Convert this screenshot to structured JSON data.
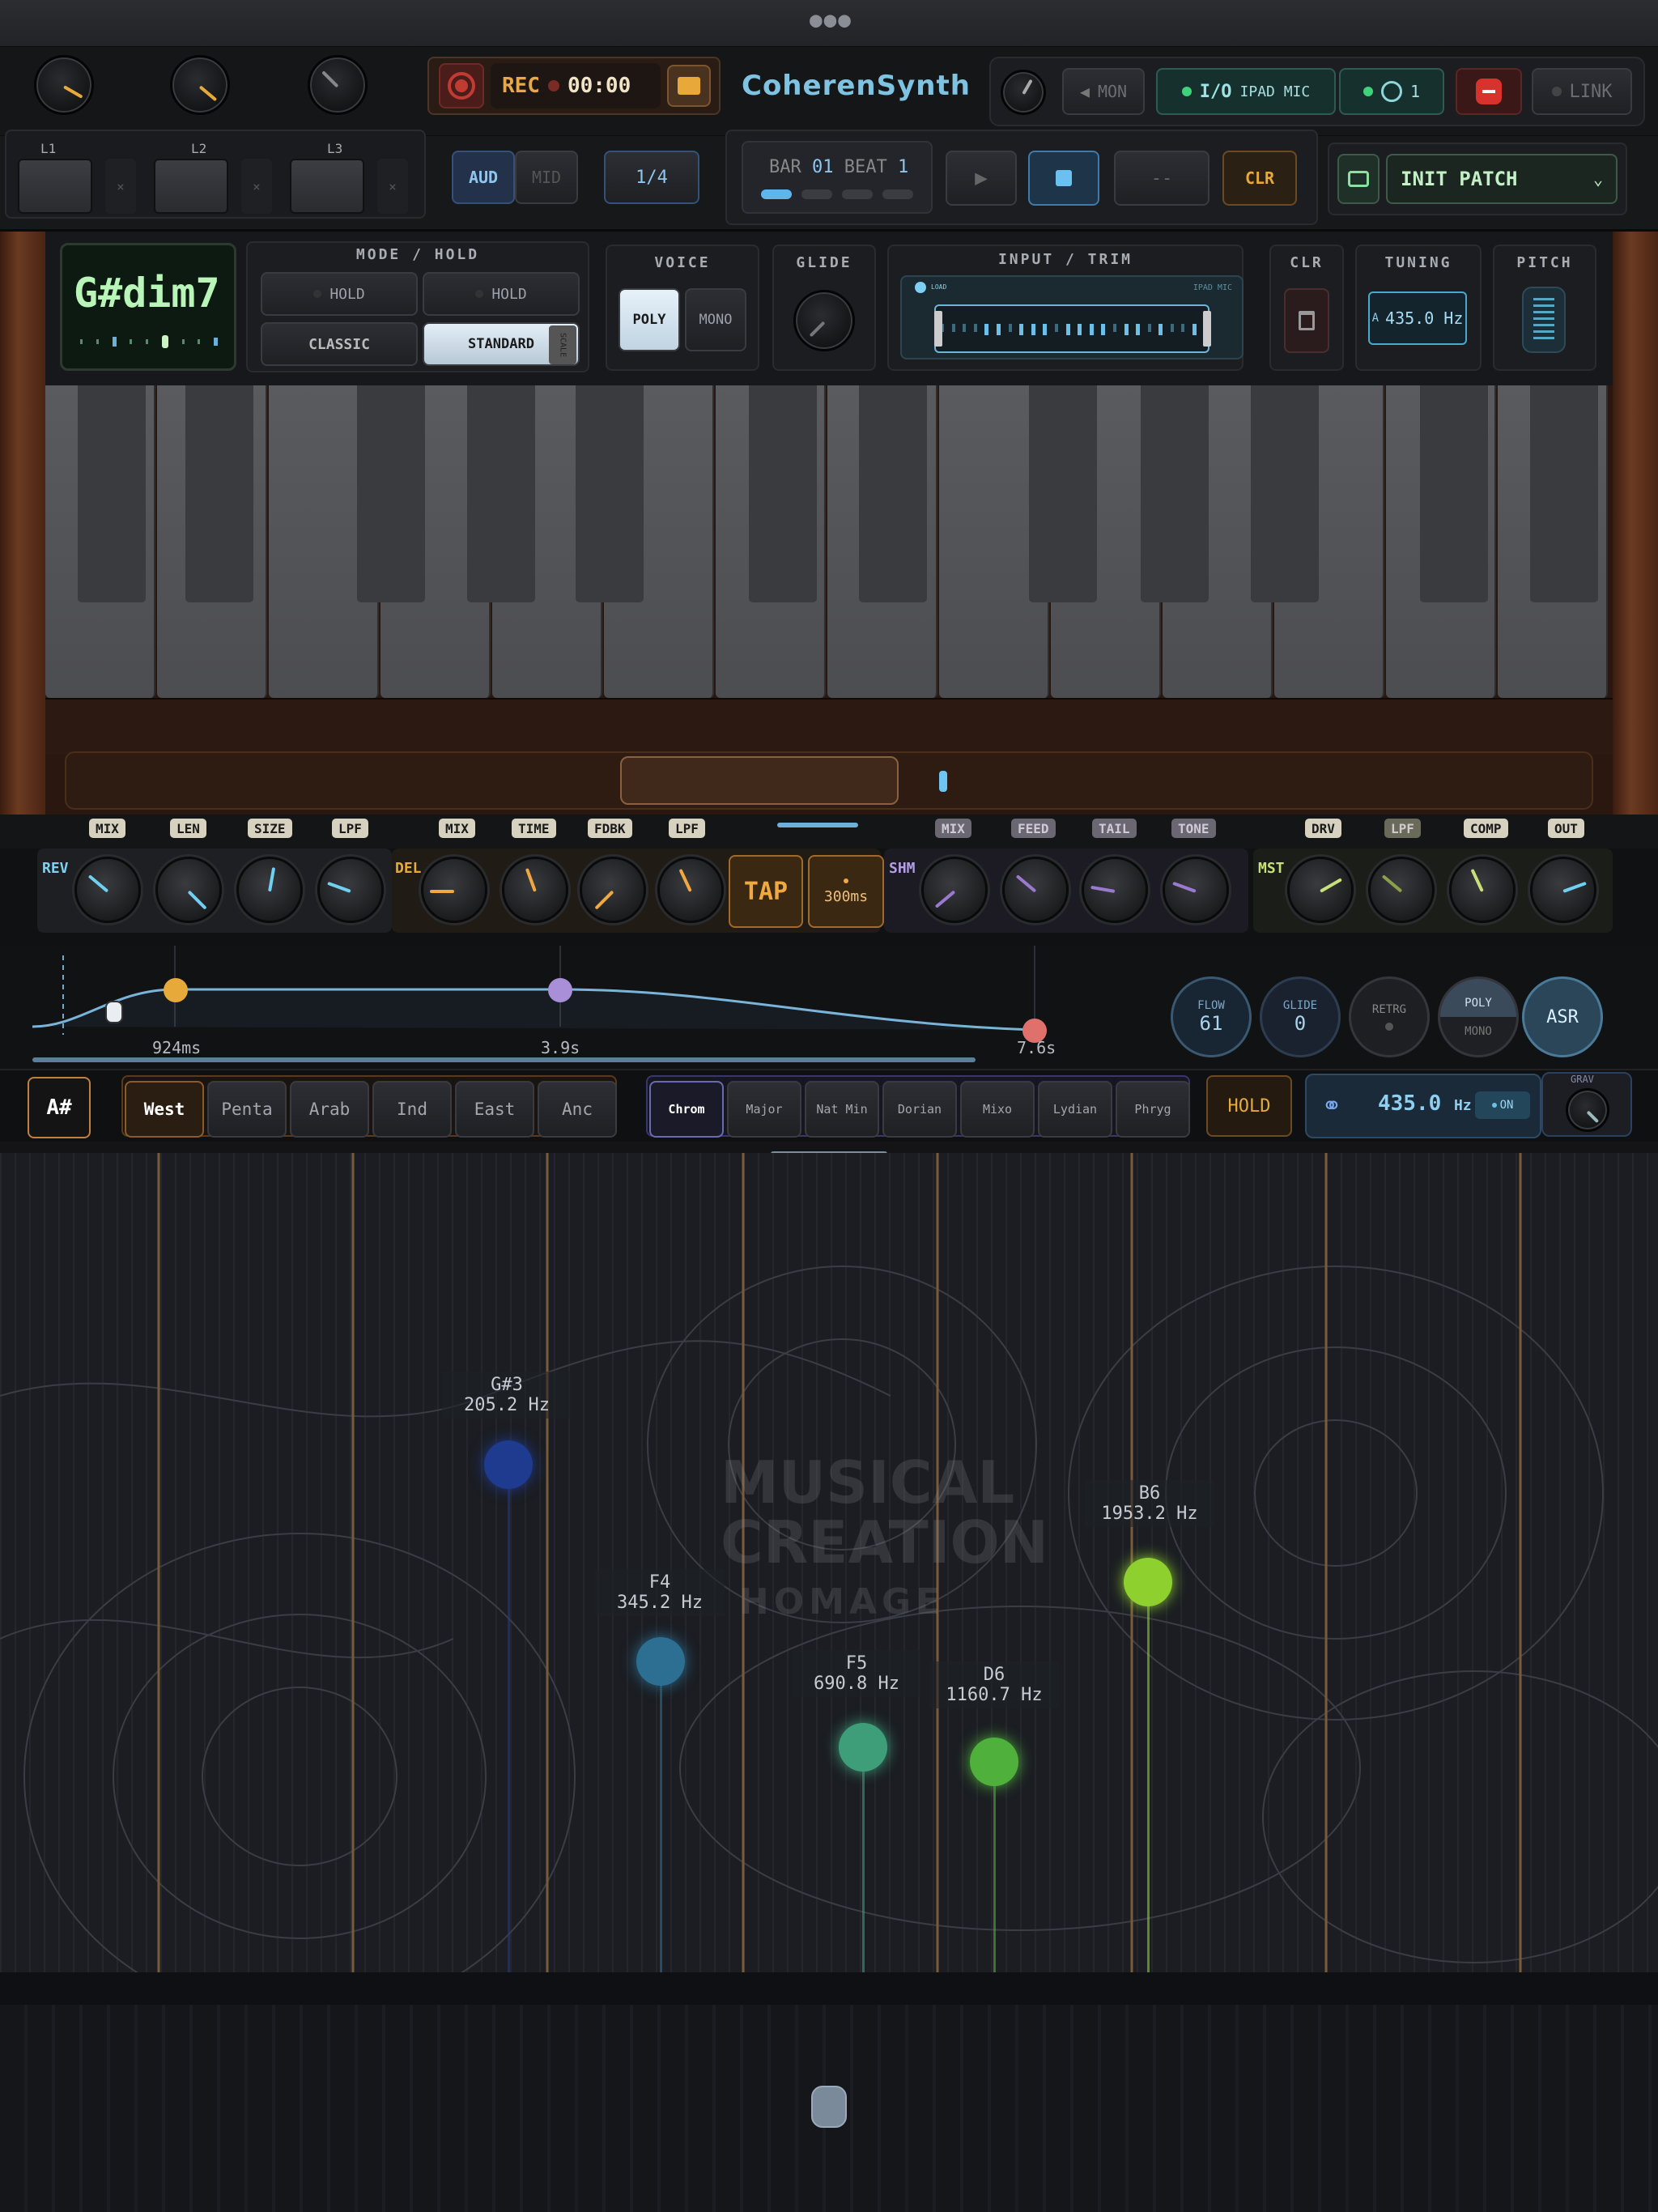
{
  "header": {
    "more_icon": "ellipsis-icon",
    "rec_label": "REC",
    "rec_time": "00:00",
    "app_title": "CoherenSynth",
    "mon_label": "MON",
    "io_label": "I/O",
    "io_source": "IPAD MIC",
    "midi_count": "1",
    "link_label": "LINK"
  },
  "loops": [
    {
      "label": "L1"
    },
    {
      "label": "L2"
    },
    {
      "label": "L3"
    }
  ],
  "transport": {
    "aud_label": "AUD",
    "mid_label": "MID",
    "quant": "1/4",
    "bar_label": "BAR",
    "bar_value": "01",
    "beat_label": "BEAT",
    "beat_value": "1",
    "dash": "--",
    "clr": "CLR"
  },
  "patch": {
    "name": "INIT PATCH"
  },
  "chord": {
    "name": "G#dim7"
  },
  "mode_hold": {
    "title": "MODE / HOLD",
    "hold1": "HOLD",
    "hold2": "HOLD",
    "classic": "CLASSIC",
    "standard": "STANDARD",
    "scale_tab": "SCALE"
  },
  "voice": {
    "title": "VOICE",
    "poly": "POLY",
    "mono": "MONO"
  },
  "glide": {
    "title": "GLIDE"
  },
  "input_trim": {
    "title": "INPUT / TRIM",
    "load": "LOAD",
    "source": "IPAD MIC"
  },
  "clr_panel": {
    "title": "CLR"
  },
  "tuning": {
    "title": "TUNING",
    "note": "A",
    "value": "435.0 Hz"
  },
  "pitch": {
    "title": "PITCH"
  },
  "fx_tags": [
    "MIX",
    "LEN",
    "SIZE",
    "LPF",
    "MIX",
    "TIME",
    "FDBK",
    "LPF",
    "MIX",
    "FEED",
    "TAIL",
    "TONE",
    "DRV",
    "LPF",
    "COMP",
    "OUT"
  ],
  "fx_sections": {
    "rev": "REV",
    "del": "DEL",
    "shm": "SHM",
    "mst": "MST",
    "tap": "TAP",
    "delay_time": "300ms"
  },
  "envelope": {
    "t1": "924ms",
    "t2": "3.9s",
    "t3": "7.6s",
    "flow_label": "FLOW",
    "flow_value": "61",
    "glide_label": "GLIDE",
    "glide_value": "0",
    "retrg": "RETRG",
    "poly": "POLY",
    "mono": "MONO",
    "asr": "ASR"
  },
  "scales": {
    "root": "A#",
    "cultures": [
      "West",
      "Penta",
      "Arab",
      "Ind",
      "East",
      "Anc"
    ],
    "modes": [
      "Chrom",
      "Major",
      "Nat Min",
      "Dorian",
      "Mixo",
      "Lydian",
      "Phryg"
    ],
    "hold": "HOLD",
    "freq": "435.0",
    "freq_unit": "Hz",
    "on": "ON",
    "grav": "GRAV"
  },
  "watermark": {
    "line1": "MUSICAL",
    "line2": "CREATION",
    "line3": "HOMAGE"
  },
  "nodes": [
    {
      "note": "G#3",
      "freq": "205.2 Hz",
      "color": "#1f3b8f"
    },
    {
      "note": "F4",
      "freq": "345.2 Hz",
      "color": "#2c6f93"
    },
    {
      "note": "F5",
      "freq": "690.8 Hz",
      "color": "#3f9e7a"
    },
    {
      "note": "D6",
      "freq": "1160.7 Hz",
      "color": "#4fb03c"
    },
    {
      "note": "B6",
      "freq": "1953.2 Hz",
      "color": "#8ed02e"
    }
  ]
}
